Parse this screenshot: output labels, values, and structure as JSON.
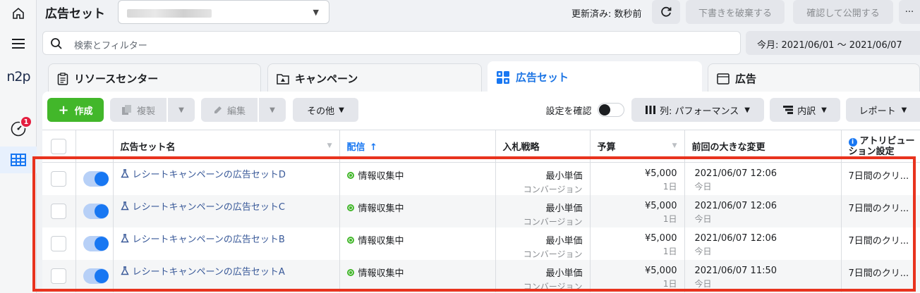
{
  "header": {
    "title": "広告セット",
    "updated": "更新済み: 数秒前",
    "discard": "下書きを破棄する",
    "publish": "確認して公開する",
    "more": "···"
  },
  "rail": {
    "logo": "n2p",
    "badge": "1"
  },
  "search": {
    "placeholder": "検索とフィルター"
  },
  "date_range": "今月: 2021/06/01 〜 2021/06/07",
  "tabs": [
    {
      "label": "リソースセンター"
    },
    {
      "label": "キャンペーン"
    },
    {
      "label": "広告セット"
    },
    {
      "label": "広告"
    }
  ],
  "toolbar": {
    "create": "作成",
    "duplicate": "複製",
    "edit": "編集",
    "other": "その他",
    "review_settings": "設定を確認",
    "columns": "列: パフォーマンス",
    "breakdown": "内訳",
    "report": "レポート"
  },
  "table": {
    "headers": {
      "name": "広告セット名",
      "delivery": "配信",
      "bid": "入札戦略",
      "budget": "予算",
      "last_change": "前回の大きな変更",
      "attribution": "アトリビューション設定"
    },
    "rows": [
      {
        "name": "レシートキャンペーンの広告セットD",
        "status": "情報収集中",
        "bid": "最小単価",
        "bid_sub": "コンバージョン",
        "budget": "¥5,000",
        "budget_sub": "1日",
        "changed": "2021/06/07 12:06",
        "changed_sub": "今日",
        "attribution": "7日間のクリ..."
      },
      {
        "name": "レシートキャンペーンの広告セットC",
        "status": "情報収集中",
        "bid": "最小単価",
        "bid_sub": "コンバージョン",
        "budget": "¥5,000",
        "budget_sub": "1日",
        "changed": "2021/06/07 12:06",
        "changed_sub": "今日",
        "attribution": "7日間のクリ..."
      },
      {
        "name": "レシートキャンペーンの広告セットB",
        "status": "情報収集中",
        "bid": "最小単価",
        "bid_sub": "コンバージョン",
        "budget": "¥5,000",
        "budget_sub": "1日",
        "changed": "2021/06/07 12:06",
        "changed_sub": "今日",
        "attribution": "7日間のクリ..."
      },
      {
        "name": "レシートキャンペーンの広告セットA",
        "status": "情報収集中",
        "bid": "最小単価",
        "bid_sub": "コンバージョン",
        "budget": "¥5,000",
        "budget_sub": "1日",
        "changed": "2021/06/07 11:50",
        "changed_sub": "今日",
        "attribution": "7日間のクリ..."
      }
    ]
  },
  "colors": {
    "accent": "#1877f2",
    "create": "#42b72a",
    "highlight": "#e8331e"
  }
}
